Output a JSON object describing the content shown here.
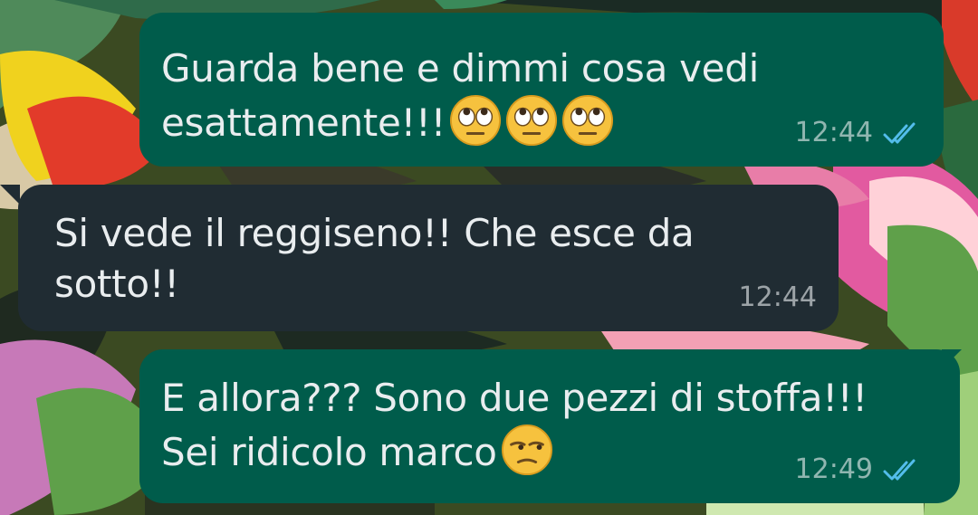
{
  "messages": [
    {
      "direction": "outgoing",
      "line1": "Guarda bene e dimmi cosa vedi",
      "line2": "esattamente!!!",
      "emoji": [
        "face-with-rolling-eyes",
        "face-with-rolling-eyes",
        "face-with-rolling-eyes"
      ],
      "time": "12:44",
      "status": "read"
    },
    {
      "direction": "incoming",
      "line1": "Si vede il reggiseno!! Che esce da",
      "line2": "sotto!!",
      "time": "12:44"
    },
    {
      "direction": "outgoing",
      "line1": "E allora??? Sono due pezzi di stoffa!!!",
      "line2": "Sei ridicolo marco",
      "emoji": [
        "unamused-face"
      ],
      "time": "12:49",
      "status": "read"
    }
  ],
  "colors": {
    "outgoing_bubble": "#005c4b",
    "incoming_bubble": "#202c33",
    "read_ticks": "#53bdeb",
    "text": "#e9edef"
  }
}
